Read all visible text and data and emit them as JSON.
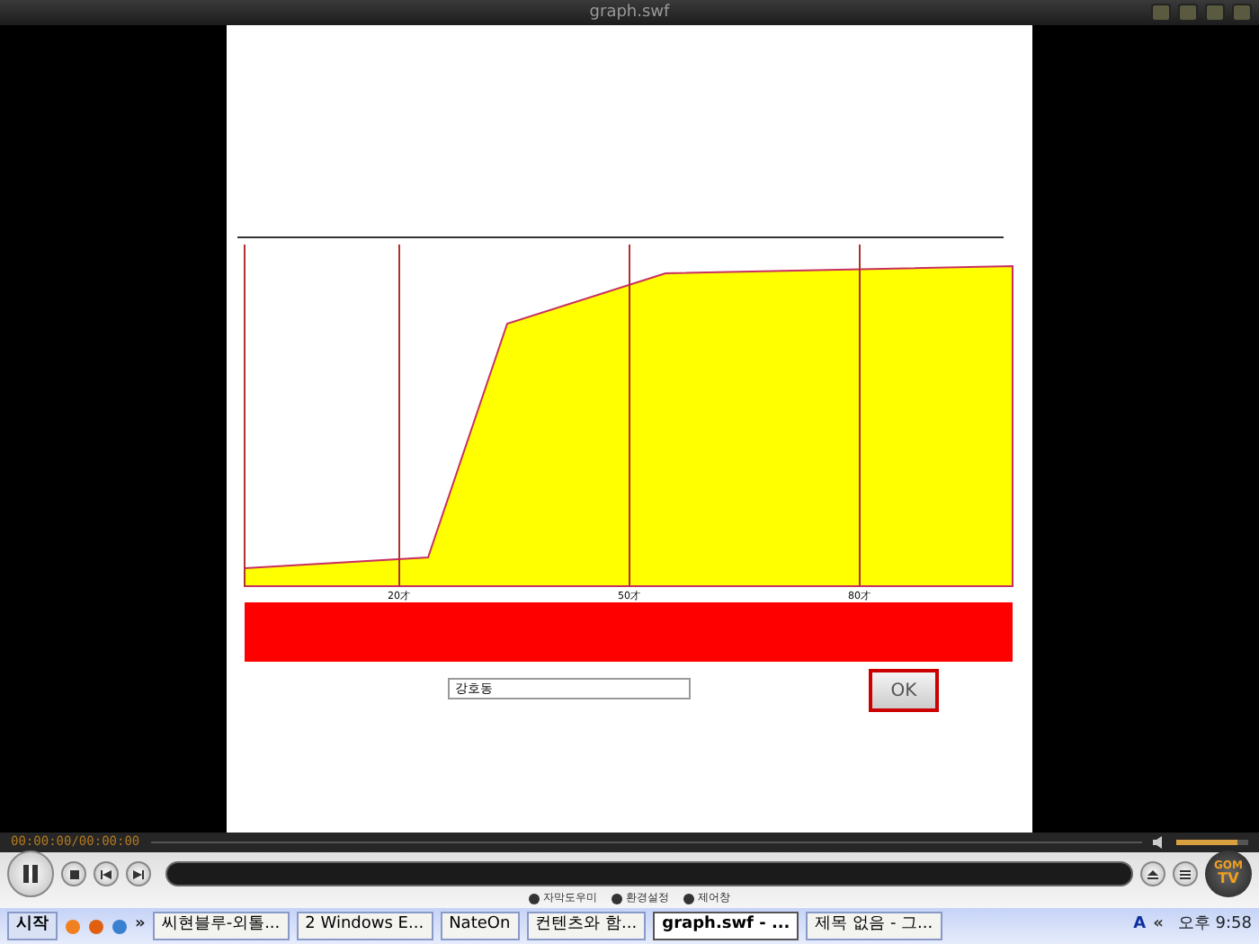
{
  "window": {
    "title": "graph.swf"
  },
  "chart": {
    "tick_labels": [
      "20才",
      "50才",
      "80才"
    ]
  },
  "name_field": {
    "value": "강호동"
  },
  "ok_button": {
    "label": "OK"
  },
  "player": {
    "time": "00:00:00/00:00:00",
    "volume": {
      "level": 0.85
    },
    "menu": [
      "자막도우미",
      "환경설정",
      "제어창"
    ],
    "logo": [
      "GOM",
      "TV"
    ]
  },
  "taskbar": {
    "start": "시작",
    "more": "»",
    "tasks": [
      {
        "label": "씨현블루-외톨...",
        "selected": false
      },
      {
        "label": "2 Windows E...",
        "selected": false
      },
      {
        "label": "NateOn",
        "selected": false
      },
      {
        "label": "컨텐츠와 함...",
        "selected": false
      },
      {
        "label": "graph.swf - ...",
        "selected": true
      },
      {
        "label": "제목 없음 - 그...",
        "selected": false
      }
    ],
    "tray": [
      "A",
      "«"
    ],
    "clock": "오후 9:58"
  }
}
